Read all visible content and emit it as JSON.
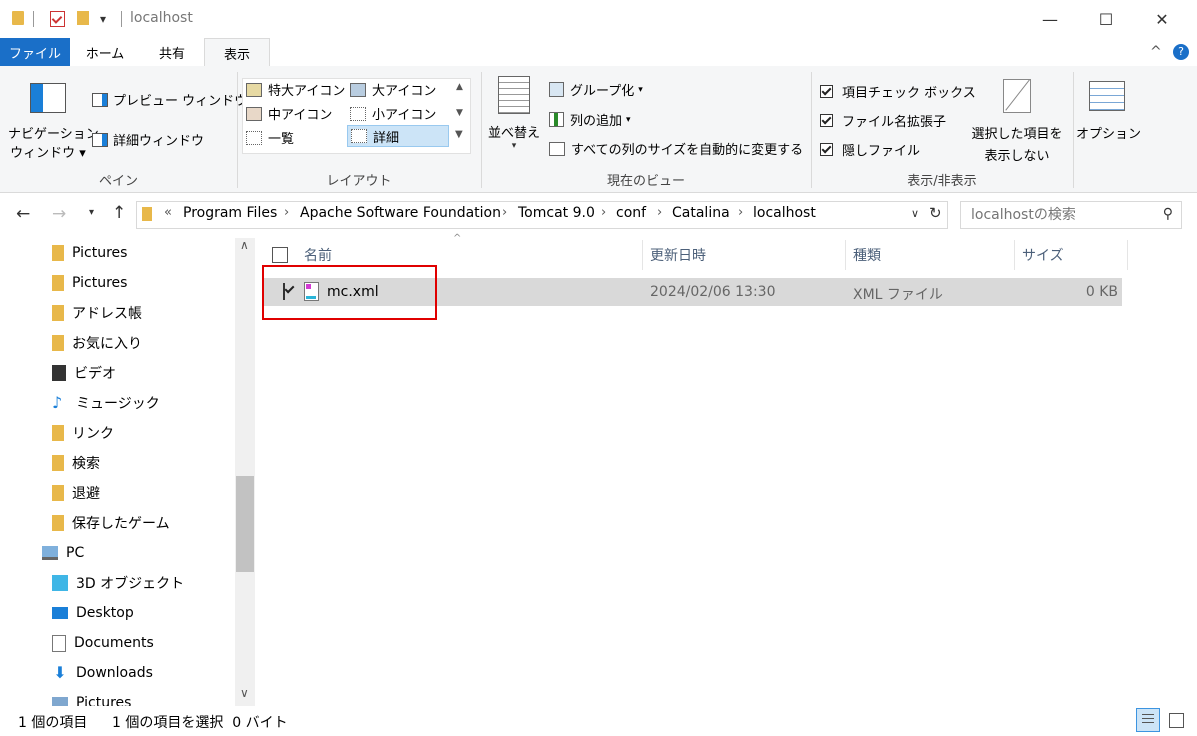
{
  "titlebar": {
    "title": "localhost",
    "qat_dropdown": "▾",
    "minimize": "—",
    "maximize": "☐",
    "close": "✕"
  },
  "tabs": [
    {
      "label": "ファイル"
    },
    {
      "label": "ホーム"
    },
    {
      "label": "共有"
    },
    {
      "label": "表示"
    }
  ],
  "ribbon": {
    "pane": {
      "nav_pane_label_1": "ナビゲーション",
      "nav_pane_label_2": "ウィンドウ",
      "preview_label": "プレビュー ウィンドウ",
      "details_label": "詳細ウィンドウ",
      "group": "ペイン"
    },
    "layout": {
      "items": [
        "特大アイコン",
        "大アイコン",
        "中アイコン",
        "小アイコン",
        "一覧",
        "詳細"
      ],
      "group": "レイアウト"
    },
    "current_view": {
      "sort_label": "並べ替え",
      "group_by": "グループ化",
      "add_column": "列の追加",
      "autosize": "すべての列のサイズを自動的に変更する",
      "group": "現在のビュー"
    },
    "show_hide": {
      "item_checkboxes": "項目チェック ボックス",
      "extensions": "ファイル名拡張子",
      "hidden": "隠しファイル",
      "hide_selected_1": "選択した項目を",
      "hide_selected_2": "表示しない",
      "group": "表示/非表示"
    },
    "options": "オプション"
  },
  "address": {
    "prefix": "«",
    "crumbs": [
      "Program Files",
      "Apache Software Foundation",
      "Tomcat 9.0",
      "conf",
      "Catalina",
      "localhost"
    ],
    "search_placeholder": "localhostの検索"
  },
  "nav": [
    {
      "label": "Pictures",
      "icon": "folder-icon"
    },
    {
      "label": "Pictures",
      "icon": "pictures-folder-icon"
    },
    {
      "label": "アドレス帳",
      "icon": "contacts-icon"
    },
    {
      "label": "お気に入り",
      "icon": "favorites-icon"
    },
    {
      "label": "ビデオ",
      "icon": "videos-icon"
    },
    {
      "label": "ミュージック",
      "icon": "music-icon"
    },
    {
      "label": "リンク",
      "icon": "links-icon"
    },
    {
      "label": "検索",
      "icon": "searches-icon"
    },
    {
      "label": "退避",
      "icon": "folder-icon"
    },
    {
      "label": "保存したゲーム",
      "icon": "saved-games-icon"
    },
    {
      "label": "PC",
      "icon": "pc-icon"
    },
    {
      "label": "3D オブジェクト",
      "icon": "3d-objects-icon"
    },
    {
      "label": "Desktop",
      "icon": "desktop-icon"
    },
    {
      "label": "Documents",
      "icon": "documents-icon"
    },
    {
      "label": "Downloads",
      "icon": "downloads-icon"
    },
    {
      "label": "Pictures",
      "icon": "pictures-icon"
    }
  ],
  "columns": [
    "名前",
    "更新日時",
    "種類",
    "サイズ"
  ],
  "files": [
    {
      "name": "mc.xml",
      "modified": "2024/02/06 13:30",
      "type": "XML ファイル",
      "size": "0 KB"
    }
  ],
  "status": {
    "count": "1 個の項目",
    "selected": "1 個の項目を選択  0 バイト"
  },
  "colors": {
    "file_tab": "#1a6fc8",
    "highlight_box": "#e00000",
    "selected_row": "#d9d9d9"
  }
}
